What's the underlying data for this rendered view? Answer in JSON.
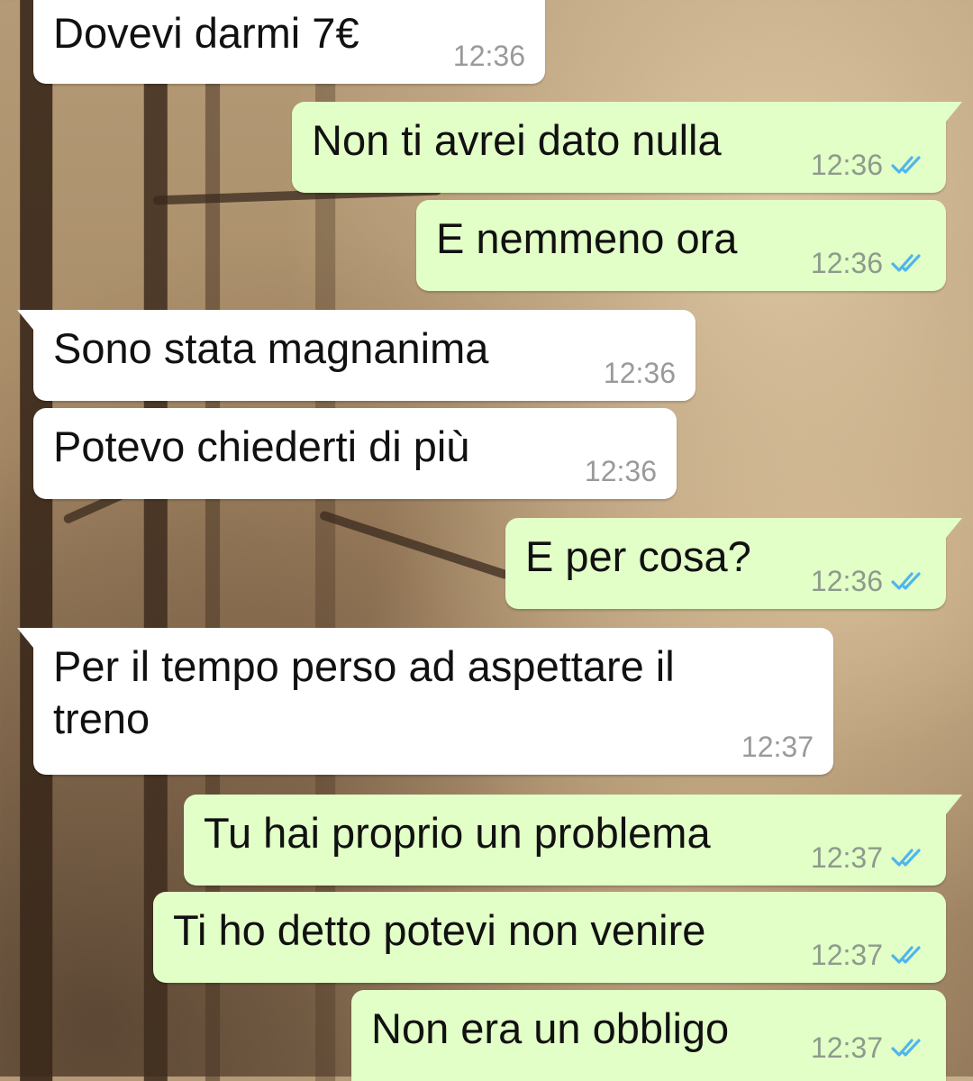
{
  "conversation": {
    "messages": [
      {
        "direction": "incoming",
        "text": "Dovevi darmi 7€",
        "time": "12:36"
      },
      {
        "direction": "outgoing",
        "text": "Non ti avrei dato nulla",
        "time": "12:36",
        "status": "read"
      },
      {
        "direction": "outgoing",
        "text": "E nemmeno ora",
        "time": "12:36",
        "status": "read"
      },
      {
        "direction": "incoming",
        "text": "Sono stata magnanima",
        "time": "12:36"
      },
      {
        "direction": "incoming",
        "text": "Potevo chiederti di più",
        "time": "12:36"
      },
      {
        "direction": "outgoing",
        "text": "E per cosa?",
        "time": "12:36",
        "status": "read"
      },
      {
        "direction": "incoming",
        "text": "Per il tempo perso ad aspettare il treno",
        "time": "12:37"
      },
      {
        "direction": "outgoing",
        "text": "Tu hai proprio un problema",
        "time": "12:37",
        "status": "read"
      },
      {
        "direction": "outgoing",
        "text": "Ti ho detto potevi non venire",
        "time": "12:37",
        "status": "read"
      },
      {
        "direction": "outgoing",
        "text": "Non era un obbligo",
        "time": "12:37",
        "status": "read"
      }
    ]
  },
  "colors": {
    "incoming_bubble": "#ffffff",
    "outgoing_bubble": "#e2ffc7",
    "read_ticks": "#4fb6ec",
    "timestamp": "#8e9a8c"
  },
  "icons": {
    "read_receipt": "double-check-icon"
  }
}
